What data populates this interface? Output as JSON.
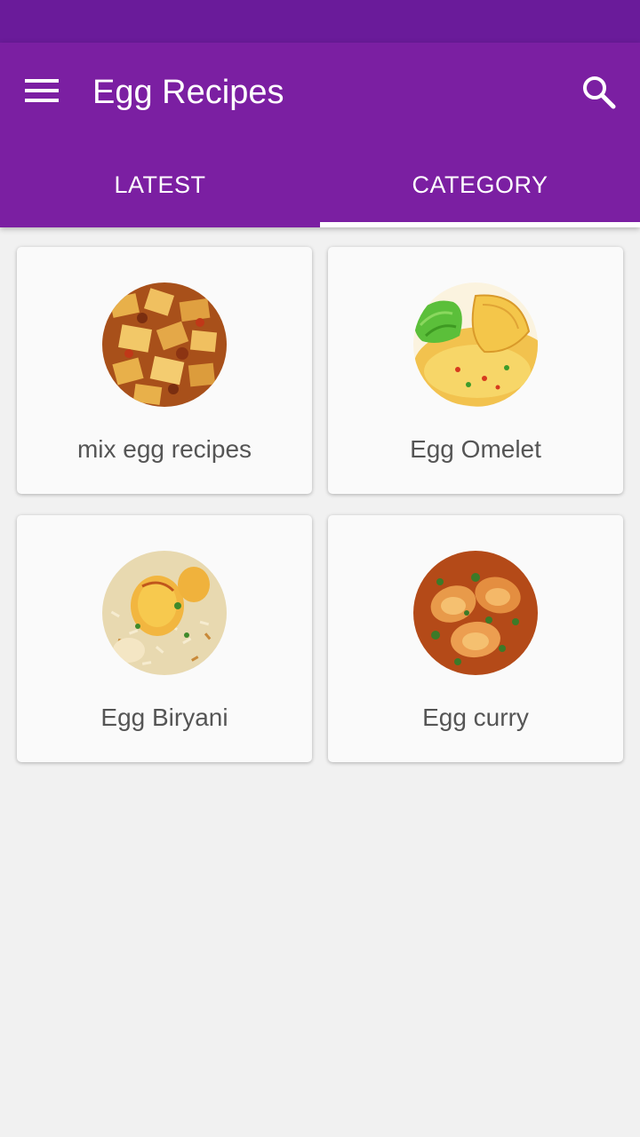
{
  "colors": {
    "status_bar": "#6a1b9a",
    "primary": "#7b1fa2",
    "background": "#f1f1f1",
    "card": "#fafafa",
    "text": "#555555"
  },
  "toolbar": {
    "title": "Egg Recipes",
    "menu_icon": "hamburger-menu-icon",
    "search_icon": "search-icon"
  },
  "tabs": [
    {
      "label": "LATEST",
      "selected": false
    },
    {
      "label": "CATEGORY",
      "selected": true
    }
  ],
  "categories": [
    {
      "label": "mix egg recipes",
      "image": "mixed-egg-dish-photo"
    },
    {
      "label": "Egg Omelet",
      "image": "omelet-with-lettuce-photo"
    },
    {
      "label": "Egg Biryani",
      "image": "egg-biryani-photo"
    },
    {
      "label": "Egg curry",
      "image": "egg-curry-photo"
    }
  ]
}
